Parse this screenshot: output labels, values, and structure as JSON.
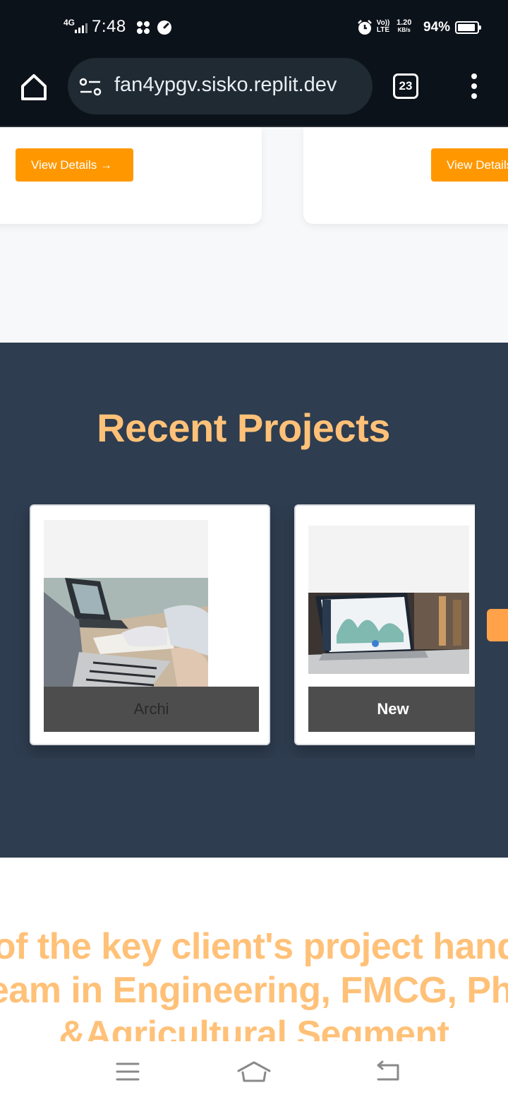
{
  "status_bar": {
    "network": "4G",
    "time": "7:48",
    "volte": "Vo)) LTE",
    "speed_value": "1.20",
    "speed_unit": "KB/s",
    "battery": "94%"
  },
  "browser": {
    "url": "fan4ypgv.sisko.replit.dev",
    "tab_count": "23"
  },
  "services": {
    "cards": [
      {
        "button_label": "View Details →"
      },
      {
        "button_label": "View Details →"
      }
    ]
  },
  "projects": {
    "heading": "Recent Projects",
    "items": [
      {
        "caption": "Archi"
      },
      {
        "caption": "New"
      }
    ]
  },
  "clients": {
    "lines": [
      "Some of the key client's project handled by",
      "our team in Engineering, FMCG, Pharma",
      "&Agricultural Segment"
    ]
  },
  "colors": {
    "accent": "#ff9800",
    "heading": "#ffc178",
    "section_bg": "#2e3d50",
    "chrome_bg": "#0c121a"
  }
}
